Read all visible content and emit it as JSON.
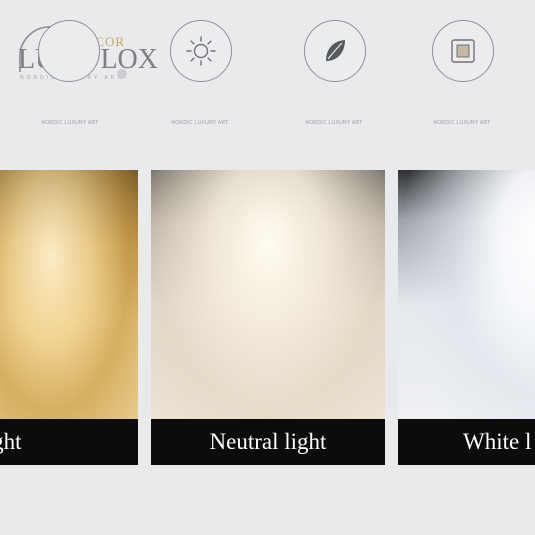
{
  "brand": {
    "name": "LUMULOX",
    "decor": "DECOR",
    "tagline": "NORDIC LUXURY ART"
  },
  "features": [
    {
      "icon": "bulb-icon",
      "caption": "NORDIC LUXURY ART"
    },
    {
      "icon": "sun-icon",
      "caption": "NORDIC LUXURY ART"
    },
    {
      "icon": "leaf-icon",
      "caption": "NORDIC LUXURY ART"
    },
    {
      "icon": "switch-icon",
      "caption": "NORDIC LUXURY ART"
    }
  ],
  "light_options": [
    {
      "label": "rm light",
      "tone": "warm",
      "color": "#e9cc8c"
    },
    {
      "label": "Neutral light",
      "tone": "neutral",
      "color": "#ece3d3"
    },
    {
      "label": "White l",
      "tone": "white",
      "color": "#eef0f3"
    }
  ]
}
